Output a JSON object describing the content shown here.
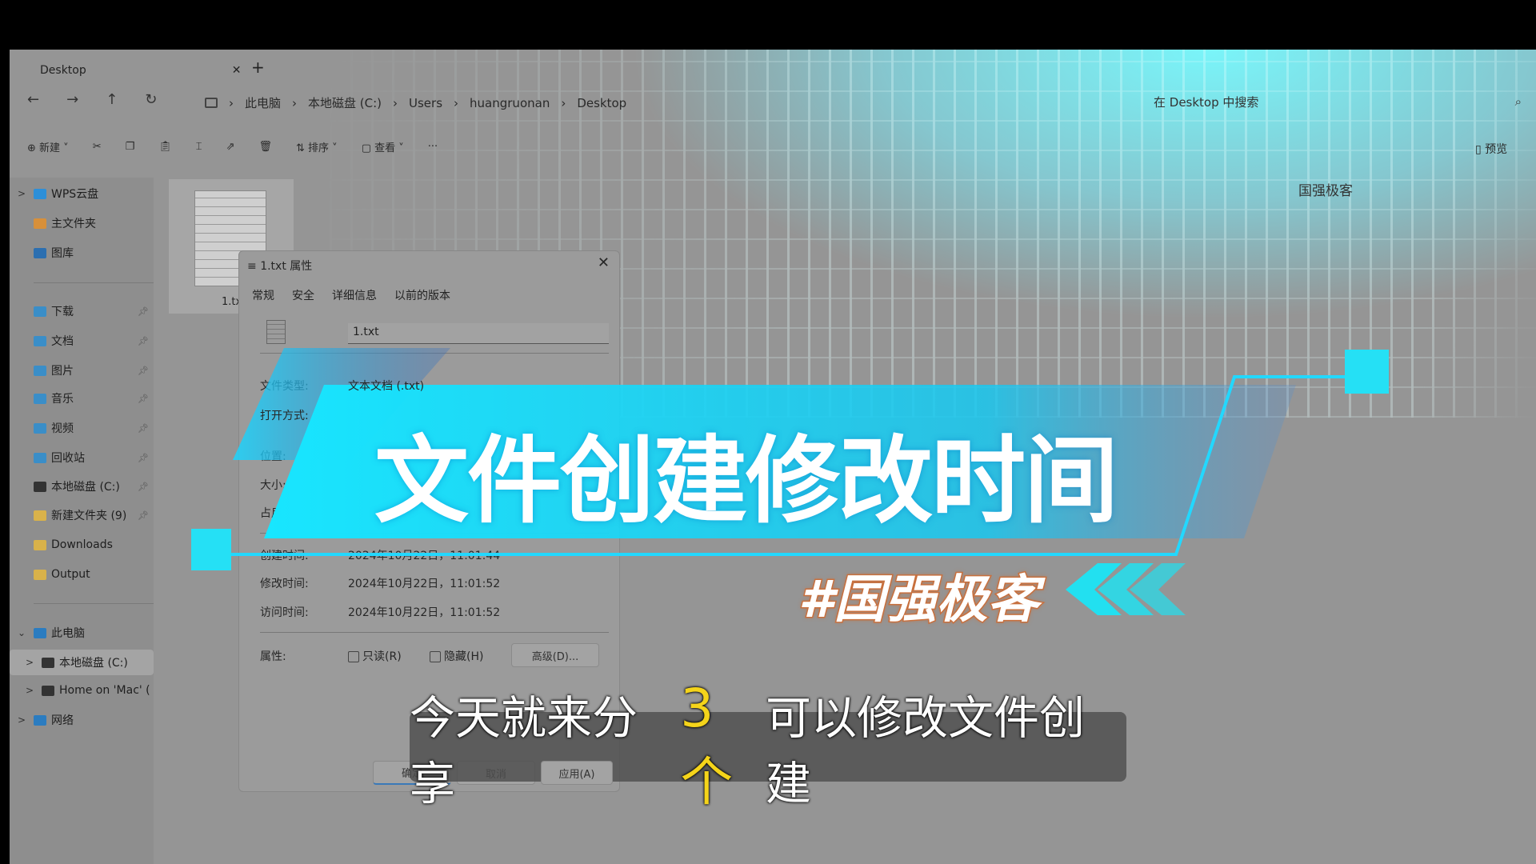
{
  "window": {
    "tab_title": "Desktop",
    "close": "✕",
    "new_tab": "+"
  },
  "nav": {
    "back": "←",
    "forward": "→",
    "up": "↑",
    "refresh": "↻",
    "breadcrumb": [
      "此电脑",
      "本地磁盘 (C:)",
      "Users",
      "huangruonan",
      "Desktop"
    ],
    "search_placeholder": "在 Desktop 中搜索"
  },
  "toolbar": {
    "new": "新建",
    "sort": "排序",
    "view": "查看",
    "more": "···",
    "preview": "预览"
  },
  "sidebar": {
    "items": [
      {
        "label": "WPS云盘",
        "icon": "cloud-icon",
        "chev": ">"
      },
      {
        "label": "主文件夹",
        "icon": "home-icon"
      },
      {
        "label": "图库",
        "icon": "gallery-icon"
      },
      {
        "label": "下载",
        "icon": "folder-download-icon",
        "pinned": true
      },
      {
        "label": "文档",
        "icon": "folder-docs-icon",
        "pinned": true
      },
      {
        "label": "图片",
        "icon": "folder-pictures-icon",
        "pinned": true
      },
      {
        "label": "音乐",
        "icon": "folder-music-icon",
        "pinned": true
      },
      {
        "label": "视频",
        "icon": "folder-video-icon",
        "pinned": true
      },
      {
        "label": "回收站",
        "icon": "recycle-bin-icon",
        "pinned": true
      },
      {
        "label": "本地磁盘 (C:)",
        "icon": "drive-icon",
        "pinned": true
      },
      {
        "label": "新建文件夹 (9)",
        "icon": "folder-icon",
        "pinned": true
      },
      {
        "label": "Downloads",
        "icon": "folder-icon"
      },
      {
        "label": "Output",
        "icon": "folder-icon"
      },
      {
        "label": "此电脑",
        "icon": "computer-icon",
        "chev": "⌄"
      },
      {
        "label": "本地磁盘 (C:)",
        "icon": "drive-icon",
        "chev": ">",
        "selected": true
      },
      {
        "label": "Home on 'Mac' (",
        "icon": "network-drive-icon",
        "chev": ">"
      },
      {
        "label": "网络",
        "icon": "network-icon",
        "chev": ">"
      }
    ]
  },
  "file": {
    "name": "1.tx"
  },
  "watermark": "国强极客",
  "dialog": {
    "title": "1.txt 属性",
    "tabs": [
      "常规",
      "安全",
      "详细信息",
      "以前的版本"
    ],
    "filename": "1.txt",
    "rows": [
      {
        "label": "文件类型:",
        "value": "文本文档 (.txt)"
      },
      {
        "label": "打开方式:",
        "value": ""
      },
      {
        "label": "位置:",
        "value": ""
      },
      {
        "label": "大小:",
        "value": ""
      },
      {
        "label": "占用",
        "value": ""
      }
    ],
    "times": [
      {
        "label": "创建时间:",
        "value": "2024年10月22日，11:01:44"
      },
      {
        "label": "修改时间:",
        "value": "2024年10月22日，11:01:52"
      },
      {
        "label": "访问时间:",
        "value": "2024年10月22日，11:01:52"
      }
    ],
    "attr_label": "属性:",
    "readonly": "只读(R)",
    "hidden": "隐藏(H)",
    "advanced": "高级(D)...",
    "ok": "确定",
    "cancel": "取消",
    "apply": "应用(A)"
  },
  "overlay": {
    "title": "文件创建修改时间",
    "tag": "#国强极客",
    "subtitle_pre": "今天就来分享",
    "subtitle_hl": "3个",
    "subtitle_post": "可以修改文件创建",
    "accent": "#1fe3ff",
    "tag_stroke": "#c8703e",
    "highlight": "#f5d41a"
  }
}
